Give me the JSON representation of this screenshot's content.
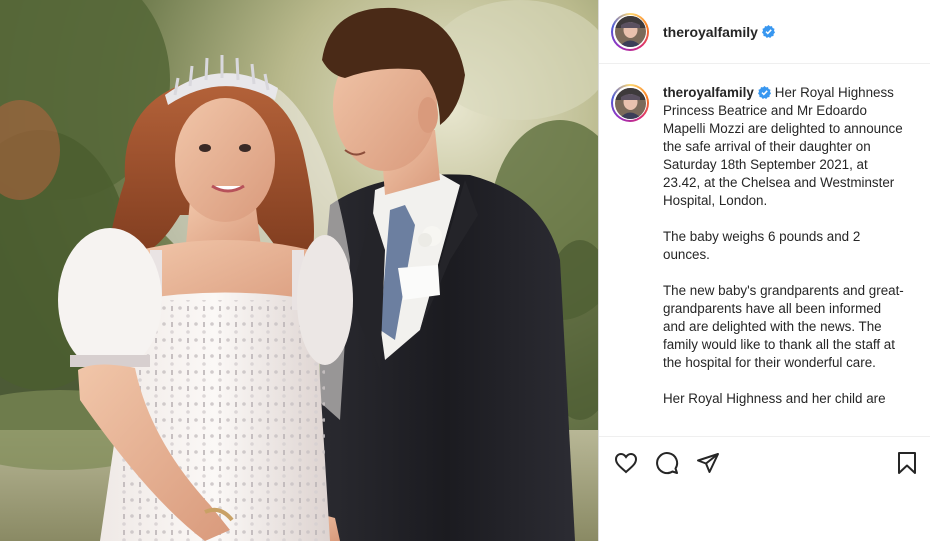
{
  "post": {
    "account": {
      "username": "theroyalfamily",
      "verified": true,
      "avatar_icon": "profile-photo"
    },
    "photo": {
      "subject_icon": "wedding-photo"
    },
    "caption": {
      "username": "theroyalfamily",
      "paragraphs": [
        "Her Royal Highness Princess Beatrice and Mr Edoardo Mapelli Mozzi are delighted to announce the safe arrival of their daughter on Saturday 18th September 2021, at 23.42, at the Chelsea and Westminster Hospital, London.",
        "The baby weighs 6 pounds and 2 ounces.",
        "The new baby's grandparents and great-grandparents have all been informed and are delighted with the news. The family would like to thank all the staff at the hospital for their wonderful care.",
        "Her Royal Highness and her child are"
      ]
    },
    "actions": {
      "like_icon": "heart-icon",
      "comment_icon": "comment-icon",
      "share_icon": "share-icon",
      "save_icon": "bookmark-icon"
    }
  },
  "colors": {
    "verified_blue": "#3897f0",
    "text": "#262626",
    "border": "#dbdbdb"
  }
}
